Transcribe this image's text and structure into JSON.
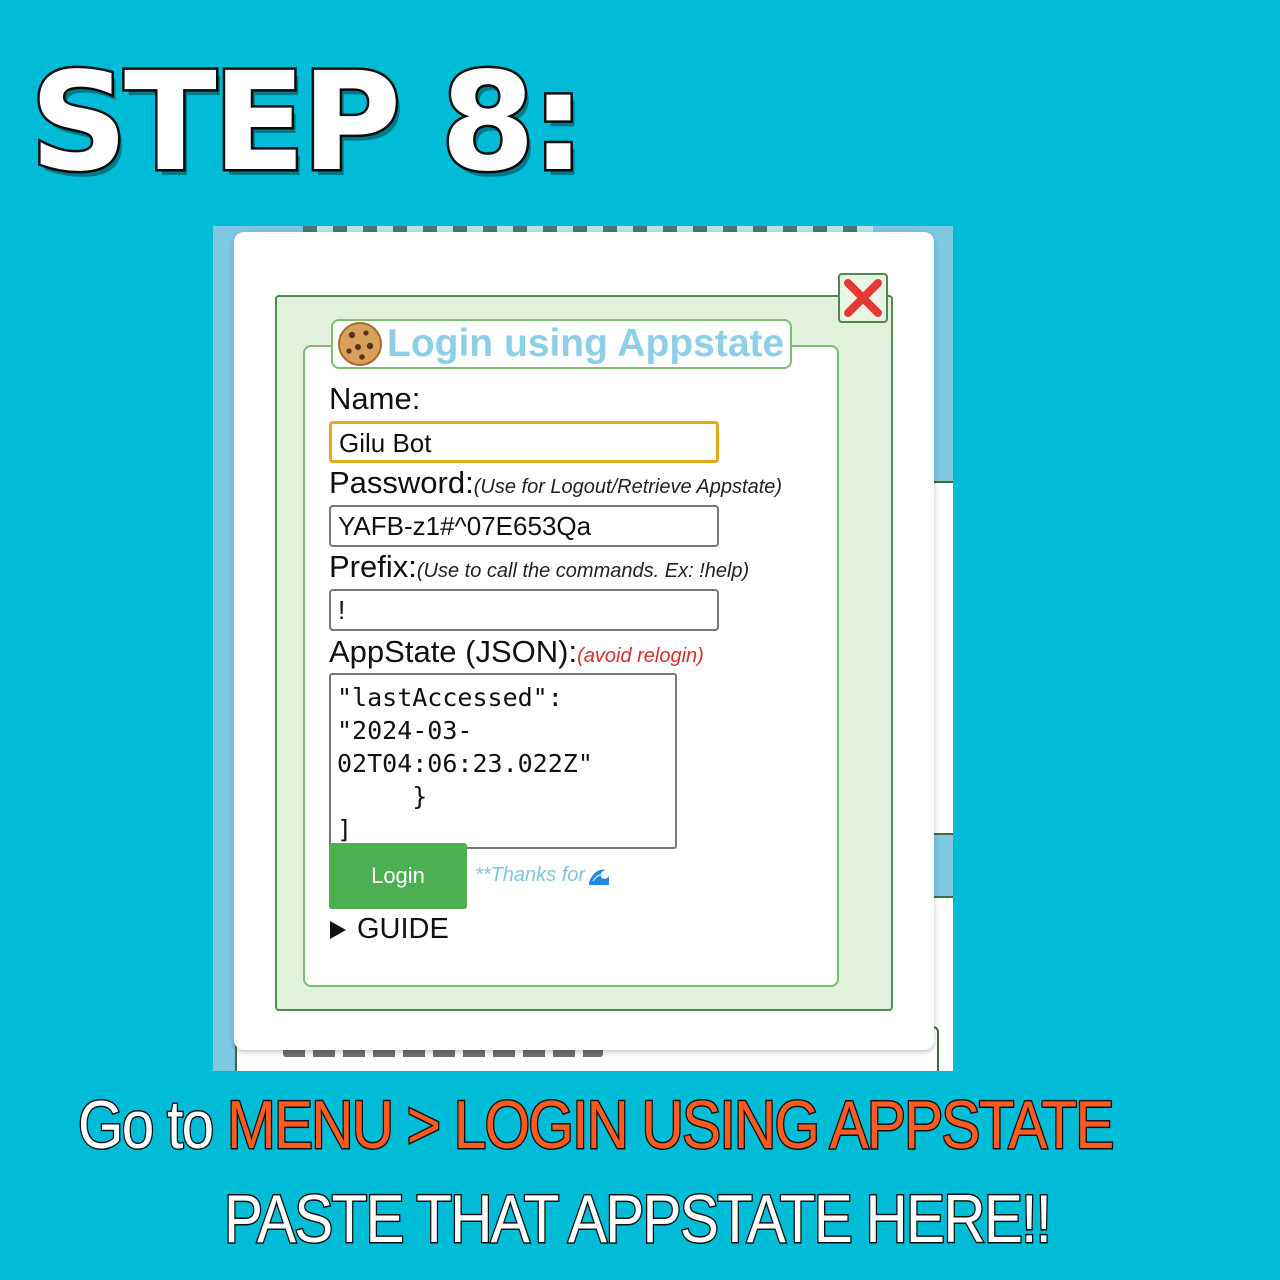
{
  "heading": "STEP 8:",
  "dialog": {
    "legend_title": "Login using Appstate",
    "legend_icon": "cookie-icon",
    "close_icon": "close-icon",
    "name_label": "Name:",
    "name_value": "Gilu Bot",
    "password_label": "Password:",
    "password_hint": "(Use for Logout/Retrieve Appstate)",
    "password_value": "YAFB-z1#^07E653Qa",
    "prefix_label": "Prefix:",
    "prefix_hint": "(Use to call the commands. Ex: !help)",
    "prefix_value": "!",
    "appstate_label": "AppState (JSON):",
    "appstate_hint": "(avoid relogin)",
    "appstate_value": "\"lastAccessed\":\n\"2024-03-\n02T04:06:23.022Z\"\n     }\n]",
    "login_button": "Login",
    "thanks_text": "**Thanks for",
    "thanks_icon": "wave-icon",
    "guide_label": "GUIDE",
    "accent_green": "#4caf50",
    "focus_color": "#e6a817"
  },
  "caption": {
    "line1_prefix": "Go to ",
    "line1_highlight": "MENU > LOGIN USING APPSTATE",
    "line2": "PASTE THAT APPSTATE HERE!!",
    "highlight_color": "#ff5a1f"
  }
}
